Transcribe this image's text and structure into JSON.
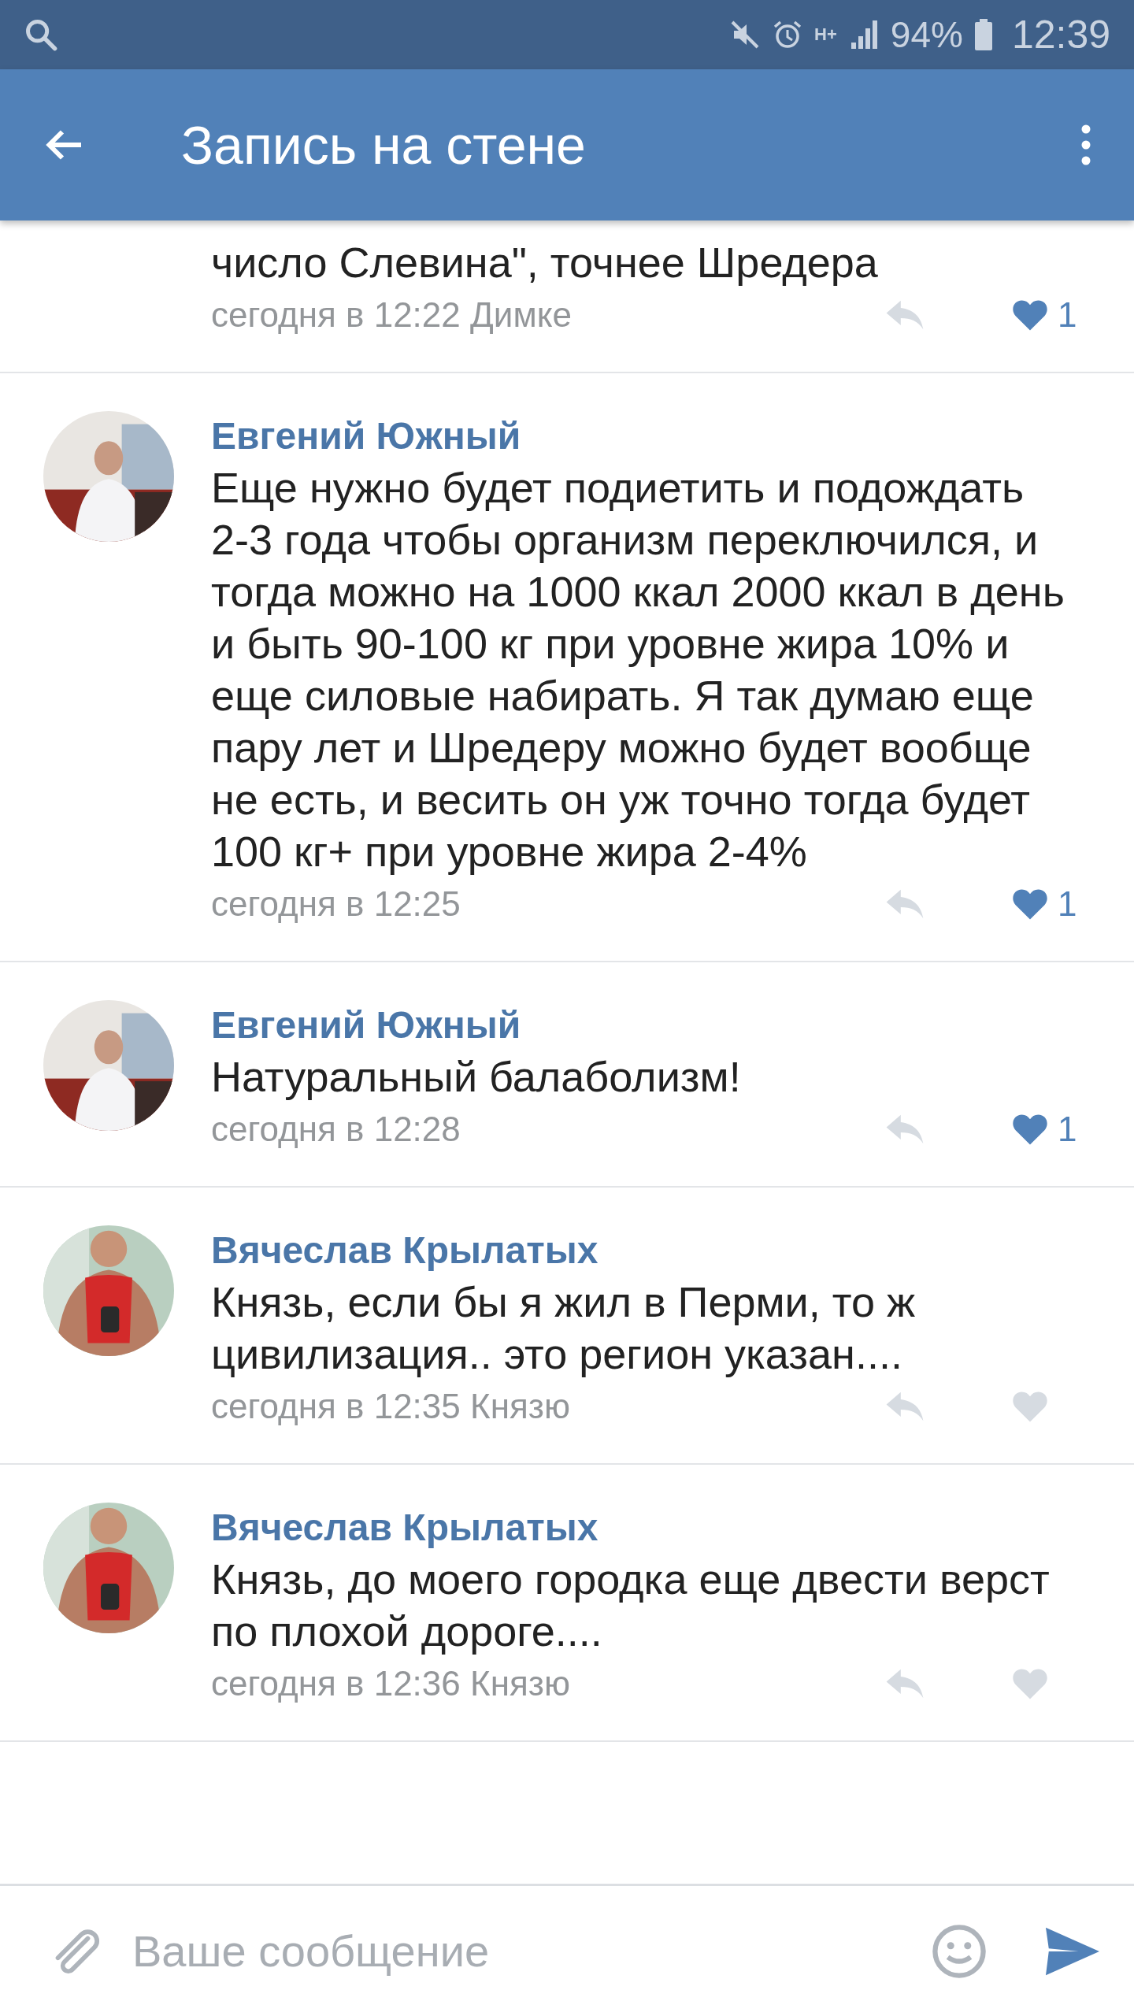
{
  "status_bar": {
    "network": "H+",
    "battery": "94%",
    "time": "12:39"
  },
  "app_bar": {
    "title": "Запись на стене"
  },
  "comments": [
    {
      "partial": true,
      "text": "число Слевина\", точнее Шредера",
      "time": "сегодня в 12:22 Димке",
      "liked": true,
      "likes": "1"
    },
    {
      "partial": false,
      "author": "Евгений Южный",
      "text": "Еще нужно будет подиетить и подождать 2-3 года чтобы организм переключился, и тогда можно на 1000 ккал 2000 ккал в день и быть 90-100 кг при уровне жира 10% и еще силовые набирать. Я так думаю еще пару лет и Шредеру можно будет вообще не есть, и весить он уж точно тогда будет 100 кг+ при уровне жира 2-4%",
      "time": "сегодня в 12:25",
      "liked": true,
      "likes": "1"
    },
    {
      "partial": false,
      "author": "Евгений Южный",
      "text": "Натуральный балаболизм!",
      "time": "сегодня в 12:28",
      "liked": true,
      "likes": "1"
    },
    {
      "partial": false,
      "author": "Вячеслав Крылатых",
      "text": "Князь, если бы я жил в Перми, то ж цивилизация.. это регион указан....",
      "time": "сегодня в 12:35 Князю",
      "liked": false
    },
    {
      "partial": false,
      "author": "Вячеслав Крылатых",
      "text": "Князь, до моего городка еще двести верст по плохой дороге....",
      "time": "сегодня в 12:36 Князю",
      "liked": false
    }
  ],
  "composer": {
    "placeholder": "Ваше сообщение"
  }
}
